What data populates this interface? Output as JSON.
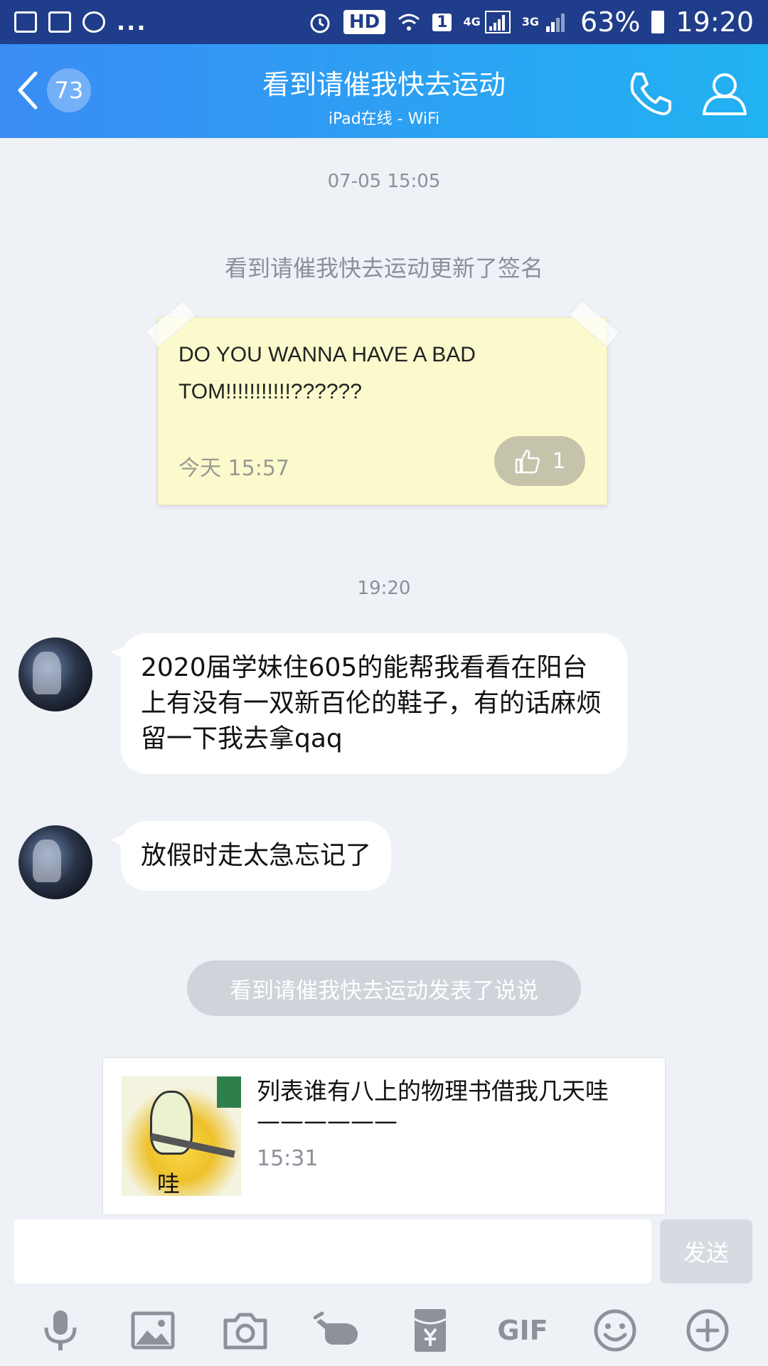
{
  "status_bar": {
    "dots": "...",
    "hd": "HD",
    "sim": "1",
    "net_4g": "4G",
    "net_3g": "3G",
    "battery": "63%",
    "time": "19:20"
  },
  "header": {
    "back_count": "73",
    "title": "看到请催我快去运动",
    "subtitle": "iPad在线 - WiFi"
  },
  "chat": {
    "timestamp_1": "07-05 15:05",
    "signature_notice": "看到请催我快去运动更新了签名",
    "signature": {
      "text": "DO YOU WANNA HAVE A BAD TOM!!!!!!!!!!!??????",
      "time": "今天 15:57",
      "likes": "1"
    },
    "timestamp_2": "19:20",
    "messages": [
      {
        "text": "2020届学妹住605的能帮我看看在阳台上有没有一双新百伦的鞋子，有的话麻烦留一下我去拿qaq"
      },
      {
        "text": "放假时走太急忘记了"
      }
    ],
    "post_notice": "看到请催我快去运动发表了说说",
    "feed": {
      "title": "列表谁有八上的物理书借我几天哇——————",
      "time": "15:31",
      "thumb_text": "哇"
    }
  },
  "input": {
    "value": "",
    "send_label": "发送"
  },
  "toolbar": {
    "gif_label": "GIF"
  },
  "colors": {
    "header_start": "#3a8cf4",
    "header_end": "#21b2f2",
    "status_bar": "#1f3d8a",
    "background": "#eef1f6",
    "signature_bg": "#fbfacd"
  }
}
